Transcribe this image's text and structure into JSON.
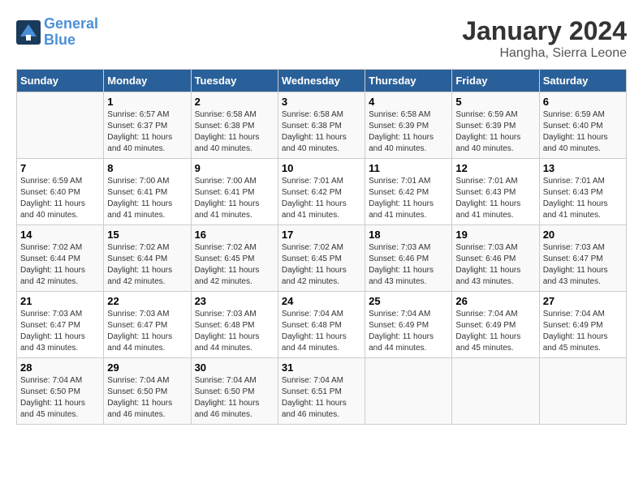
{
  "logo": {
    "line1": "General",
    "line2": "Blue"
  },
  "title": "January 2024",
  "subtitle": "Hangha, Sierra Leone",
  "weekdays": [
    "Sunday",
    "Monday",
    "Tuesday",
    "Wednesday",
    "Thursday",
    "Friday",
    "Saturday"
  ],
  "weeks": [
    [
      {
        "day": null,
        "sunrise": null,
        "sunset": null,
        "daylight": null
      },
      {
        "day": "1",
        "sunrise": "Sunrise: 6:57 AM",
        "sunset": "Sunset: 6:37 PM",
        "daylight": "Daylight: 11 hours and 40 minutes."
      },
      {
        "day": "2",
        "sunrise": "Sunrise: 6:58 AM",
        "sunset": "Sunset: 6:38 PM",
        "daylight": "Daylight: 11 hours and 40 minutes."
      },
      {
        "day": "3",
        "sunrise": "Sunrise: 6:58 AM",
        "sunset": "Sunset: 6:38 PM",
        "daylight": "Daylight: 11 hours and 40 minutes."
      },
      {
        "day": "4",
        "sunrise": "Sunrise: 6:58 AM",
        "sunset": "Sunset: 6:39 PM",
        "daylight": "Daylight: 11 hours and 40 minutes."
      },
      {
        "day": "5",
        "sunrise": "Sunrise: 6:59 AM",
        "sunset": "Sunset: 6:39 PM",
        "daylight": "Daylight: 11 hours and 40 minutes."
      },
      {
        "day": "6",
        "sunrise": "Sunrise: 6:59 AM",
        "sunset": "Sunset: 6:40 PM",
        "daylight": "Daylight: 11 hours and 40 minutes."
      }
    ],
    [
      {
        "day": "7",
        "sunrise": "Sunrise: 6:59 AM",
        "sunset": "Sunset: 6:40 PM",
        "daylight": "Daylight: 11 hours and 40 minutes."
      },
      {
        "day": "8",
        "sunrise": "Sunrise: 7:00 AM",
        "sunset": "Sunset: 6:41 PM",
        "daylight": "Daylight: 11 hours and 41 minutes."
      },
      {
        "day": "9",
        "sunrise": "Sunrise: 7:00 AM",
        "sunset": "Sunset: 6:41 PM",
        "daylight": "Daylight: 11 hours and 41 minutes."
      },
      {
        "day": "10",
        "sunrise": "Sunrise: 7:01 AM",
        "sunset": "Sunset: 6:42 PM",
        "daylight": "Daylight: 11 hours and 41 minutes."
      },
      {
        "day": "11",
        "sunrise": "Sunrise: 7:01 AM",
        "sunset": "Sunset: 6:42 PM",
        "daylight": "Daylight: 11 hours and 41 minutes."
      },
      {
        "day": "12",
        "sunrise": "Sunrise: 7:01 AM",
        "sunset": "Sunset: 6:43 PM",
        "daylight": "Daylight: 11 hours and 41 minutes."
      },
      {
        "day": "13",
        "sunrise": "Sunrise: 7:01 AM",
        "sunset": "Sunset: 6:43 PM",
        "daylight": "Daylight: 11 hours and 41 minutes."
      }
    ],
    [
      {
        "day": "14",
        "sunrise": "Sunrise: 7:02 AM",
        "sunset": "Sunset: 6:44 PM",
        "daylight": "Daylight: 11 hours and 42 minutes."
      },
      {
        "day": "15",
        "sunrise": "Sunrise: 7:02 AM",
        "sunset": "Sunset: 6:44 PM",
        "daylight": "Daylight: 11 hours and 42 minutes."
      },
      {
        "day": "16",
        "sunrise": "Sunrise: 7:02 AM",
        "sunset": "Sunset: 6:45 PM",
        "daylight": "Daylight: 11 hours and 42 minutes."
      },
      {
        "day": "17",
        "sunrise": "Sunrise: 7:02 AM",
        "sunset": "Sunset: 6:45 PM",
        "daylight": "Daylight: 11 hours and 42 minutes."
      },
      {
        "day": "18",
        "sunrise": "Sunrise: 7:03 AM",
        "sunset": "Sunset: 6:46 PM",
        "daylight": "Daylight: 11 hours and 43 minutes."
      },
      {
        "day": "19",
        "sunrise": "Sunrise: 7:03 AM",
        "sunset": "Sunset: 6:46 PM",
        "daylight": "Daylight: 11 hours and 43 minutes."
      },
      {
        "day": "20",
        "sunrise": "Sunrise: 7:03 AM",
        "sunset": "Sunset: 6:47 PM",
        "daylight": "Daylight: 11 hours and 43 minutes."
      }
    ],
    [
      {
        "day": "21",
        "sunrise": "Sunrise: 7:03 AM",
        "sunset": "Sunset: 6:47 PM",
        "daylight": "Daylight: 11 hours and 43 minutes."
      },
      {
        "day": "22",
        "sunrise": "Sunrise: 7:03 AM",
        "sunset": "Sunset: 6:47 PM",
        "daylight": "Daylight: 11 hours and 44 minutes."
      },
      {
        "day": "23",
        "sunrise": "Sunrise: 7:03 AM",
        "sunset": "Sunset: 6:48 PM",
        "daylight": "Daylight: 11 hours and 44 minutes."
      },
      {
        "day": "24",
        "sunrise": "Sunrise: 7:04 AM",
        "sunset": "Sunset: 6:48 PM",
        "daylight": "Daylight: 11 hours and 44 minutes."
      },
      {
        "day": "25",
        "sunrise": "Sunrise: 7:04 AM",
        "sunset": "Sunset: 6:49 PM",
        "daylight": "Daylight: 11 hours and 44 minutes."
      },
      {
        "day": "26",
        "sunrise": "Sunrise: 7:04 AM",
        "sunset": "Sunset: 6:49 PM",
        "daylight": "Daylight: 11 hours and 45 minutes."
      },
      {
        "day": "27",
        "sunrise": "Sunrise: 7:04 AM",
        "sunset": "Sunset: 6:49 PM",
        "daylight": "Daylight: 11 hours and 45 minutes."
      }
    ],
    [
      {
        "day": "28",
        "sunrise": "Sunrise: 7:04 AM",
        "sunset": "Sunset: 6:50 PM",
        "daylight": "Daylight: 11 hours and 45 minutes."
      },
      {
        "day": "29",
        "sunrise": "Sunrise: 7:04 AM",
        "sunset": "Sunset: 6:50 PM",
        "daylight": "Daylight: 11 hours and 46 minutes."
      },
      {
        "day": "30",
        "sunrise": "Sunrise: 7:04 AM",
        "sunset": "Sunset: 6:50 PM",
        "daylight": "Daylight: 11 hours and 46 minutes."
      },
      {
        "day": "31",
        "sunrise": "Sunrise: 7:04 AM",
        "sunset": "Sunset: 6:51 PM",
        "daylight": "Daylight: 11 hours and 46 minutes."
      },
      {
        "day": null,
        "sunrise": null,
        "sunset": null,
        "daylight": null
      },
      {
        "day": null,
        "sunrise": null,
        "sunset": null,
        "daylight": null
      },
      {
        "day": null,
        "sunrise": null,
        "sunset": null,
        "daylight": null
      }
    ]
  ]
}
